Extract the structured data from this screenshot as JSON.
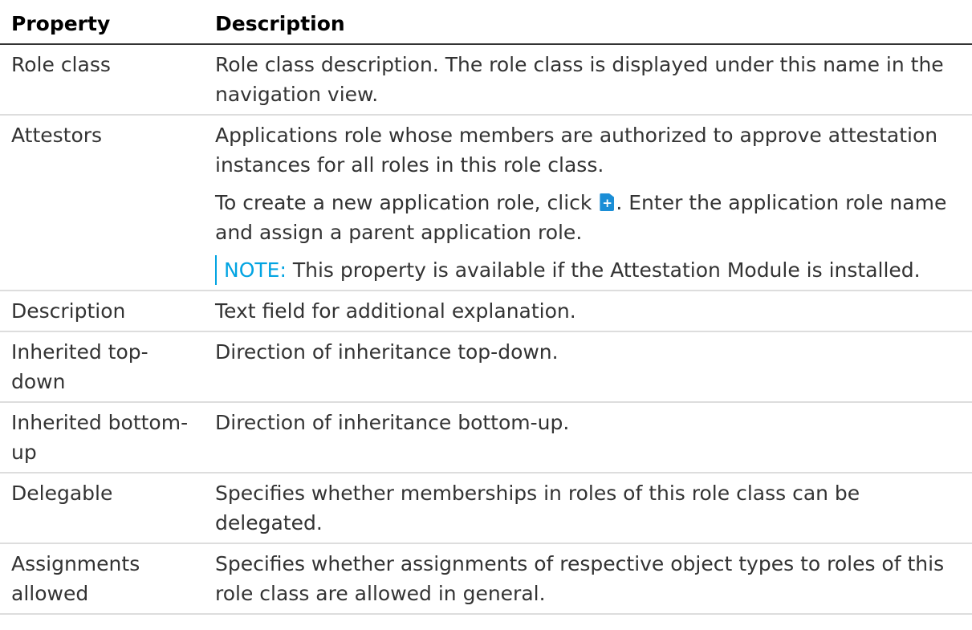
{
  "table": {
    "header": {
      "property": "Property",
      "description": "Description"
    },
    "rows": {
      "role_class": {
        "property": "Role class",
        "description": "Role class description. The role class is displayed under this name in the navigation view."
      },
      "attestors": {
        "property": "Attestors",
        "description": "Applications role whose members are authorized to approve attestation instances for all roles in this role class.",
        "create_before": "To create a new application role, click ",
        "create_icon": "add-new-icon",
        "create_after": ". Enter the application role name and assign a parent application role.",
        "note_label": "NOTE:",
        "note_text": " This property is available if the Attestation Module is installed."
      },
      "description": {
        "property": "Description",
        "description": "Text field for additional explanation."
      },
      "inherited_top_down": {
        "property": "Inherited top-down",
        "description": "Direction of inheritance top-down."
      },
      "inherited_bottom_up": {
        "property": "Inherited bottom-up",
        "description": "Direction of inheritance bottom-up."
      },
      "delegable": {
        "property": "Delegable",
        "description": "Specifies whether memberships in roles of this role class can be delegated."
      },
      "assignments_allowed": {
        "property": "Assignments allowed",
        "description": "Specifies whether assignments of respective object types to roles of this role class are allowed in general."
      }
    }
  },
  "colors": {
    "note_accent": "#02a4e2",
    "icon_blue": "#1b8ed6",
    "row_divider": "#dddddd",
    "header_divider": "#333333"
  }
}
